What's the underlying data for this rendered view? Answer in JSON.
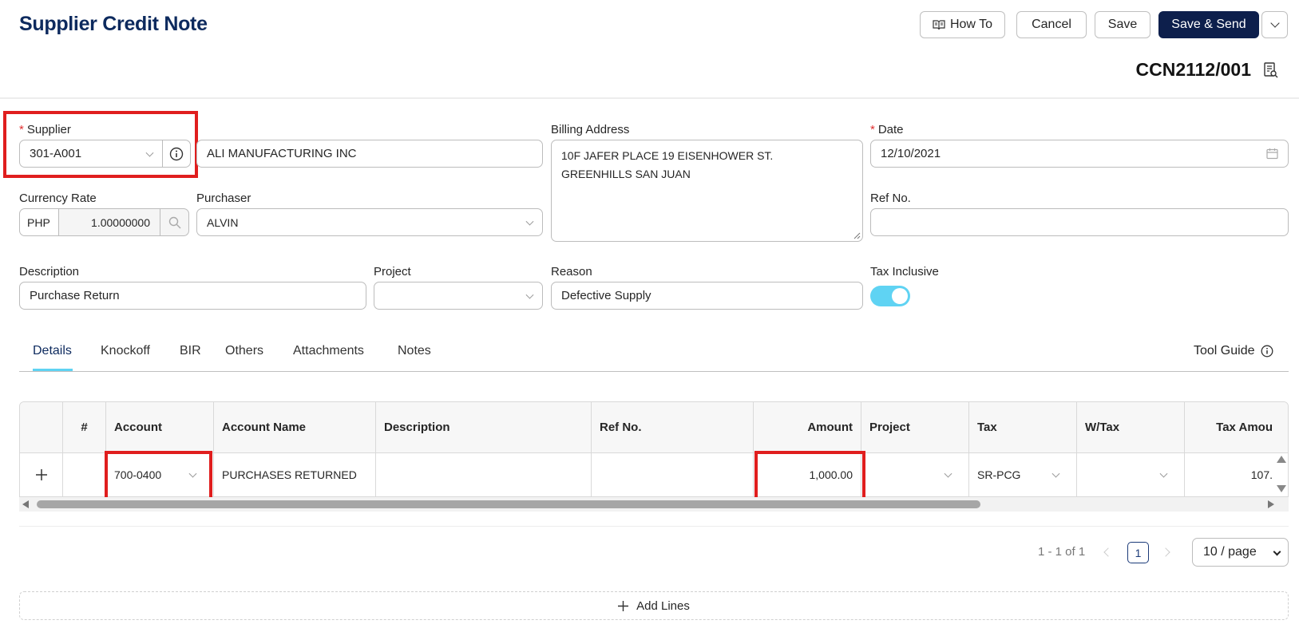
{
  "header": {
    "title": "Supplier Credit Note",
    "how_to": "How To",
    "cancel": "Cancel",
    "save": "Save",
    "save_send": "Save & Send",
    "doc_no": "CCN2112/001"
  },
  "form": {
    "supplier_label": "Supplier",
    "supplier_code": "301-A001",
    "supplier_name": "ALI MANUFACTURING INC",
    "billing_label": "Billing Address",
    "billing_line1": "10F JAFER PLACE 19 EISENHOWER ST.",
    "billing_line2": "GREENHILLS SAN JUAN",
    "date_label": "Date",
    "date_value": "12/10/2021",
    "currency_label": "Currency Rate",
    "currency_code": "PHP",
    "currency_rate": "1.00000000",
    "purchaser_label": "Purchaser",
    "purchaser_value": "ALVIN",
    "refno_label": "Ref No.",
    "refno_value": "",
    "description_label": "Description",
    "description_value": "Purchase Return",
    "project_label": "Project",
    "project_value": "",
    "reason_label": "Reason",
    "reason_value": "Defective Supply",
    "tax_inclusive_label": "Tax Inclusive",
    "tax_inclusive_on": true
  },
  "tabs": [
    "Details",
    "Knockoff",
    "BIR",
    "Others",
    "Attachments",
    "Notes"
  ],
  "tool_guide": "Tool Guide",
  "table": {
    "headers": [
      "#",
      "Account",
      "Account Name",
      "Description",
      "Ref No.",
      "Amount",
      "Project",
      "Tax",
      "W/Tax",
      "Tax Amou"
    ],
    "row": {
      "num": "",
      "account": "700-0400",
      "account_name": "PURCHASES RETURNED",
      "description": "",
      "ref_no": "",
      "amount": "1,000.00",
      "project": "",
      "tax": "SR-PCG",
      "wtax": "",
      "tax_amount": "107."
    }
  },
  "pagination": {
    "range": "1 - 1 of 1",
    "current_page": "1",
    "page_size": "10 / page"
  },
  "add_lines": "Add Lines",
  "colors": {
    "navy": "#0d1f4c",
    "highlight": "#e01e1e",
    "toggle": "#5fd3f3"
  }
}
